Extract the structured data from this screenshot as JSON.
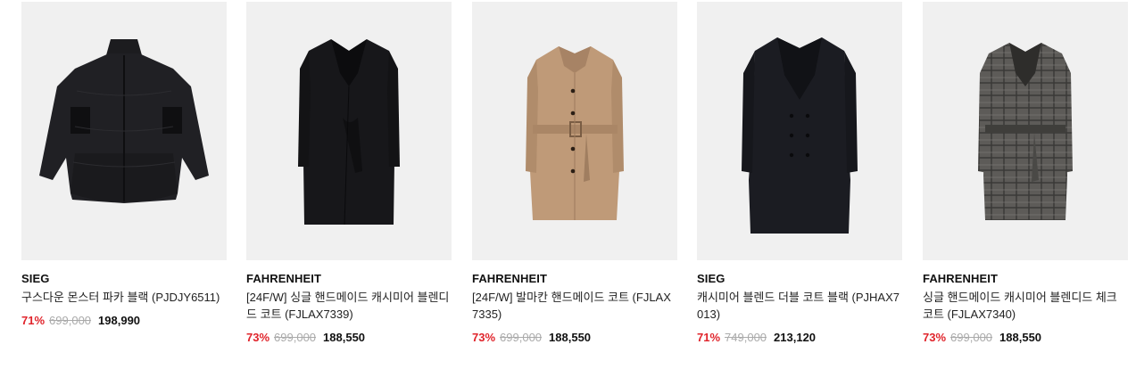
{
  "products": [
    {
      "brand": "SIEG",
      "name": "구스다운 몬스터 파카 블랙 (PJDJY6511)",
      "discount": "71%",
      "original_price": "699,000",
      "sale_price": "198,990",
      "image_icon": "puffer-parka-image"
    },
    {
      "brand": "FAHRENHEIT",
      "name": "[24F/W] 싱글 핸드메이드 캐시미어 블렌디드 코트 (FJLAX7339)",
      "discount": "73%",
      "original_price": "699,000",
      "sale_price": "188,550",
      "image_icon": "black-belted-coat-image"
    },
    {
      "brand": "FAHRENHEIT",
      "name": "[24F/W] 발마칸 핸드메이드 코트 (FJLAX7335)",
      "discount": "73%",
      "original_price": "699,000",
      "sale_price": "188,550",
      "image_icon": "camel-balmacaan-coat-image"
    },
    {
      "brand": "SIEG",
      "name": "캐시미어 블렌드 더블 코트 블랙 (PJHAX7013)",
      "discount": "71%",
      "original_price": "749,000",
      "sale_price": "213,120",
      "image_icon": "black-double-coat-image"
    },
    {
      "brand": "FAHRENHEIT",
      "name": "싱글 핸드메이드 캐시미어 블렌디드 체크 코트 (FJLAX7340)",
      "discount": "73%",
      "original_price": "699,000",
      "sale_price": "188,550",
      "image_icon": "grey-check-coat-image"
    }
  ],
  "colors": {
    "discount": "#e0242b",
    "image_bg": "#f0f0f0",
    "strike": "#aaaaaa"
  }
}
